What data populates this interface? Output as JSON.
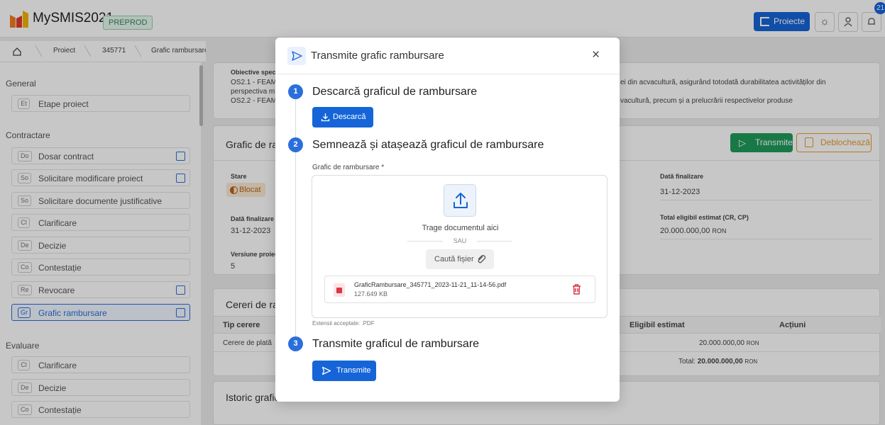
{
  "app": {
    "name": "MySMIS2021",
    "env_badge": "PREPROD"
  },
  "topbar": {
    "projects_label": "Proiecte",
    "notification_count": "21"
  },
  "breadcrumb": [
    "Proiect",
    "345771",
    "Grafic rambursare"
  ],
  "sidebar": {
    "sections": [
      {
        "title": "General",
        "items": [
          {
            "abbr": "Et",
            "label": "Etape proiect",
            "editable": false
          }
        ]
      },
      {
        "title": "Contractare",
        "items": [
          {
            "abbr": "Do",
            "label": "Dosar contract",
            "editable": true
          },
          {
            "abbr": "So",
            "label": "Solicitare modificare proiect",
            "editable": true
          },
          {
            "abbr": "So",
            "label": "Solicitare documente justificative",
            "editable": false
          },
          {
            "abbr": "Cl",
            "label": "Clarificare",
            "editable": false
          },
          {
            "abbr": "De",
            "label": "Decizie",
            "editable": false
          },
          {
            "abbr": "Co",
            "label": "Contestație",
            "editable": false
          },
          {
            "abbr": "Re",
            "label": "Revocare",
            "editable": true
          },
          {
            "abbr": "Gr",
            "label": "Grafic rambursare",
            "editable": true,
            "active": true
          }
        ]
      },
      {
        "title": "Evaluare",
        "items": [
          {
            "abbr": "Cl",
            "label": "Clarificare",
            "editable": false
          },
          {
            "abbr": "De",
            "label": "Decizie",
            "editable": false
          },
          {
            "abbr": "Co",
            "label": "Contestație",
            "editable": false
          }
        ]
      }
    ]
  },
  "background": {
    "objectives_label": "Obiective speci",
    "objective_lines": [
      "OS2.1 - FEAM",
      "perspectiva m",
      "OS2.2 - FEAM"
    ],
    "objective_right_1": "ei din acvacultură, asigurând totodată durabilitatea activităților din",
    "objective_right_2": "vacultură, precum și a prelucrării respectivelor produse",
    "grafic_card_title": "Grafic de ram",
    "transmit_label": "Transmite",
    "unlock_label": "Deblochează",
    "stare_label": "Stare",
    "stare_value": "Blocat",
    "data_finalizare_label": "Dată finalizare",
    "data_finalizare_value": "31-12-2023",
    "data_finalizare_right_label": "Dată finalizare",
    "data_finalizare_right_value": "31-12-2023",
    "total_eligibil_label": "Total eligibil estimat (CR, CP)",
    "total_eligibil_value": "20.000.000,00",
    "total_eligibil_unit": "RON",
    "versiune_label": "Versiune proiec",
    "versiune_value": "5",
    "cereri_title": "Cereri de ram",
    "col_tip": "Tip cerere",
    "col_eligibil": "Eligibil estimat",
    "col_actiuni": "Acțiuni",
    "row_tip": "Cerere de plată",
    "row_value": "20.000.000,00",
    "row_unit": "RON",
    "total_label": "Total:",
    "total_value": "20.000.000,00",
    "total_unit": "RON",
    "istoric_title": "Istoric grafic"
  },
  "modal": {
    "title": "Transmite grafic rambursare",
    "close": "×",
    "step1": {
      "num": "1",
      "title": "Descarcă graficul de rambursare",
      "button": "Descarcă"
    },
    "step2": {
      "num": "2",
      "title": "Semnează și atașează graficul de rambursare",
      "field_label": "Grafic de rambursare *",
      "drag_text": "Trage documentul aici",
      "or_text": "SAU",
      "search_button": "Caută fișier",
      "file_name": "GraficRambursare_345771_2023-11-21_11-14-56.pdf",
      "file_size": "127.649 KB",
      "accepted": "Extensii acceptate: .PDF"
    },
    "step3": {
      "num": "3",
      "title": "Transmite graficul de rambursare",
      "button": "Transmite"
    }
  },
  "colors": {
    "primary": "#1565d8",
    "success": "#1f9c5b",
    "warning": "#e79a2e",
    "danger": "#d93646"
  }
}
